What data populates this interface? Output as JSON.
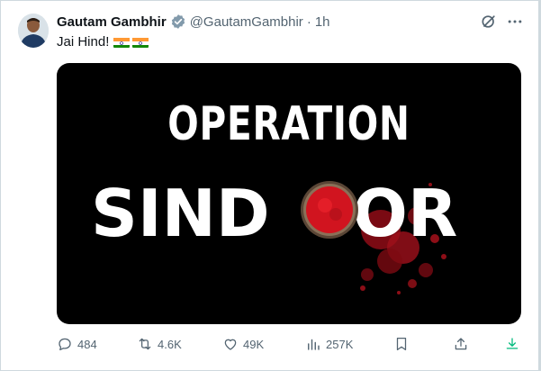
{
  "post": {
    "author_name": "Gautam Gambhir",
    "handle": "@GautamGambhir",
    "separator": "·",
    "time": "1h",
    "text": "Jai Hind!",
    "flag_icons": [
      "india-flag-icon",
      "india-flag-icon"
    ],
    "media": {
      "line1": "OPERATION",
      "line2_prefix": "SIND",
      "line2_suffix": "OR"
    },
    "actions": {
      "replies": "484",
      "reposts": "4.6K",
      "likes": "49K",
      "views": "257K"
    }
  },
  "colors": {
    "text_primary": "#0f1419",
    "text_secondary": "#536471",
    "verified_blue": "#1d9bf0",
    "download_green": "#00ba7c",
    "sindoor_red": "#c1121f"
  },
  "icons": {
    "verified": "verified-badge-icon",
    "grok": "grok-icon",
    "more": "more-icon",
    "reply": "reply-icon",
    "repost": "repost-icon",
    "like": "like-icon",
    "views": "views-icon",
    "bookmark": "bookmark-icon",
    "share": "share-icon",
    "download": "download-icon"
  }
}
